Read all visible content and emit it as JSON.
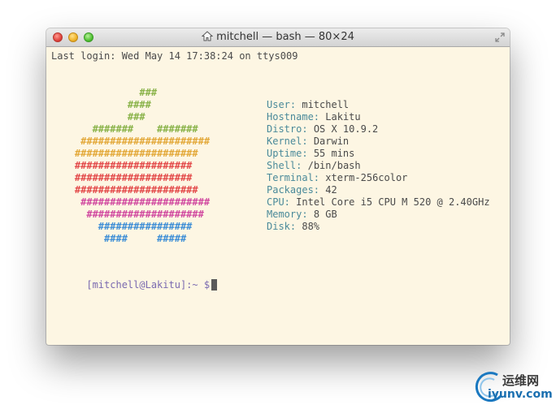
{
  "window": {
    "title": "mitchell — bash — 80×24"
  },
  "terminal": {
    "last_login": "Last login: Wed May 14 17:38:24 on ttys009",
    "logo_lines": [
      {
        "text": "               ###",
        "color": "#8ab34a"
      },
      {
        "text": "             ####",
        "color": "#8ab34a"
      },
      {
        "text": "             ###",
        "color": "#8ab34a"
      },
      {
        "text": "       #######    #######",
        "color": "#8ab34a"
      },
      {
        "text": "     ######################",
        "color": "#e3a93a"
      },
      {
        "text": "    #####################",
        "color": "#e3a93a"
      },
      {
        "text": "    ####################",
        "color": "#e34a4a"
      },
      {
        "text": "    ####################",
        "color": "#e34a4a"
      },
      {
        "text": "    #####################",
        "color": "#e34a4a"
      },
      {
        "text": "     ######################",
        "color": "#d14aa0"
      },
      {
        "text": "      ####################",
        "color": "#d14aa0"
      },
      {
        "text": "        ################",
        "color": "#3f8fd6"
      },
      {
        "text": "         ####     #####",
        "color": "#3f8fd6"
      }
    ],
    "info": [
      {
        "key": "User:",
        "value": "mitchell"
      },
      {
        "key": "Hostname:",
        "value": "Lakitu"
      },
      {
        "key": "Distro:",
        "value": "OS X 10.9.2"
      },
      {
        "key": "Kernel:",
        "value": "Darwin"
      },
      {
        "key": "Uptime:",
        "value": "55 mins"
      },
      {
        "key": "Shell:",
        "value": "/bin/bash"
      },
      {
        "key": "Terminal:",
        "value": "xterm-256color"
      },
      {
        "key": "Packages:",
        "value": "42"
      },
      {
        "key": "CPU:",
        "value": "Intel Core i5 CPU M 520 @ 2.40GHz"
      },
      {
        "key": "Memory:",
        "value": "8 GB"
      },
      {
        "key": "Disk:",
        "value": "88%"
      }
    ],
    "prompt": "[mitchell@Lakitu]:~ $",
    "prompt_color": "#7a6ab0"
  },
  "watermark": {
    "cn": "运维网",
    "url": "iyunv.com"
  }
}
